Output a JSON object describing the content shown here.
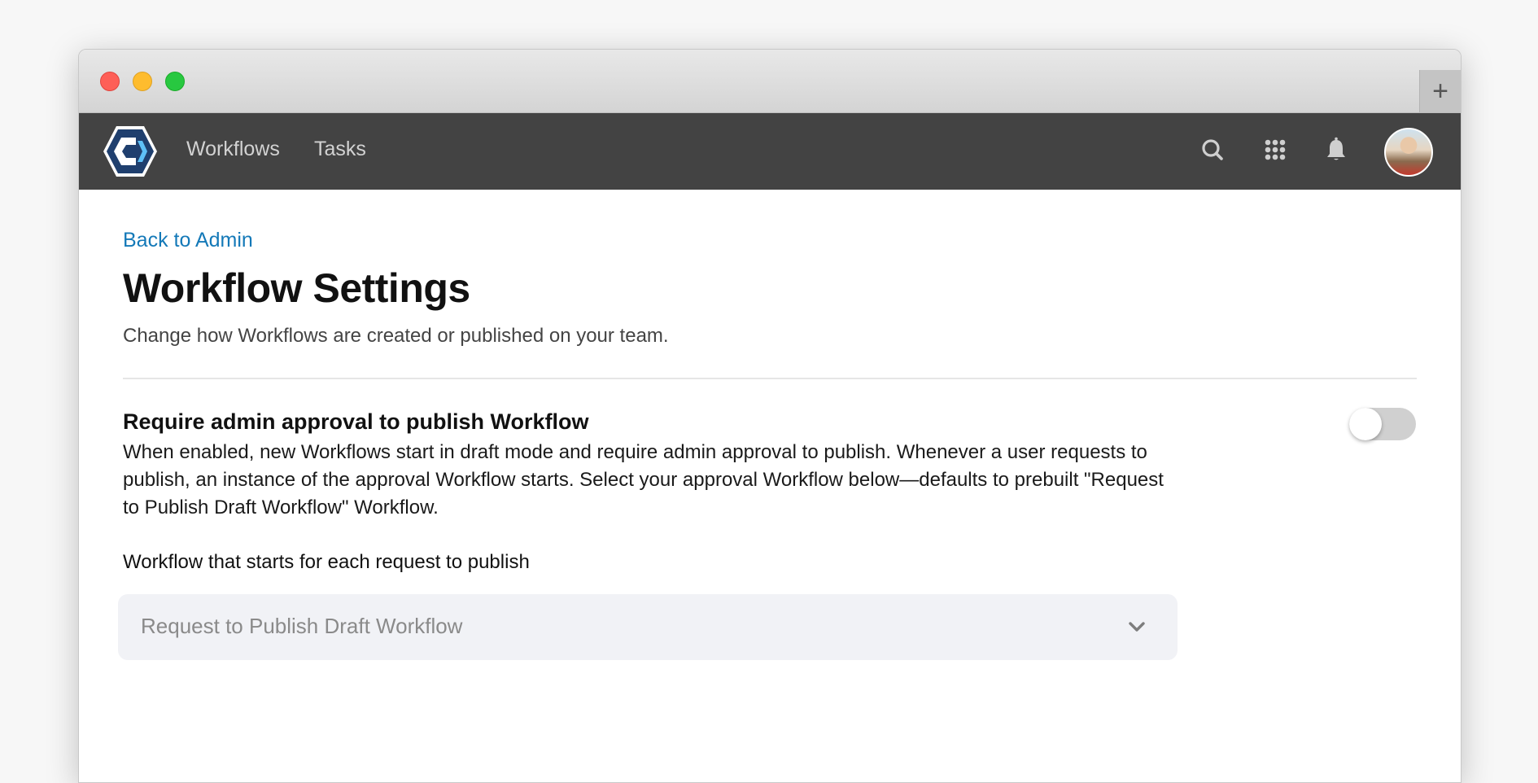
{
  "window": {
    "controls": [
      "close",
      "minimize",
      "maximize"
    ],
    "new_tab_label": "+"
  },
  "navbar": {
    "logo": "app-logo-hexagon",
    "links": [
      {
        "label": "Workflows"
      },
      {
        "label": "Tasks"
      }
    ],
    "icons": [
      "search-icon",
      "apps-grid-icon",
      "bell-icon"
    ],
    "avatar": "user-avatar"
  },
  "page": {
    "back_link": "Back to Admin",
    "title": "Workflow Settings",
    "subtitle": "Change how Workflows are created or published on your team."
  },
  "setting": {
    "title": "Require admin approval to publish Workflow",
    "description": "When enabled, new Workflows start in draft mode and require admin approval to publish. Whenever a user requests to publish, an instance of the approval Workflow starts. Select your approval Workflow below—defaults to prebuilt \"Request to Publish Draft Workflow\" Workflow.",
    "toggle_on": false,
    "field_label": "Workflow that starts for each request to publish",
    "selected_workflow": "Request to Publish Draft Workflow"
  },
  "colors": {
    "navbar": "#434343",
    "link": "#1479b8",
    "logo_navy": "#1f3f6e",
    "logo_accent": "#5ec0f7",
    "toggle_off": "#d0d0d0",
    "select_bg": "#f1f2f6"
  }
}
